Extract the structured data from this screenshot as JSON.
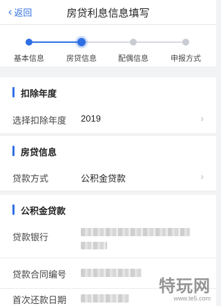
{
  "header": {
    "back_label": "返回",
    "title": "房贷利息信息填写"
  },
  "steps": [
    {
      "label": "基本信息",
      "state": "done"
    },
    {
      "label": "房贷信息",
      "state": "current"
    },
    {
      "label": "配偶信息",
      "state": "todo"
    },
    {
      "label": "申报方式",
      "state": "todo"
    }
  ],
  "sections": {
    "deduction_year": {
      "title": "扣除年度",
      "select_label": "选择扣除年度",
      "select_value": "2019"
    },
    "loan_info": {
      "title": "房贷信息",
      "method_label": "贷款方式",
      "method_value": "公积金贷款"
    },
    "provident_loan": {
      "title": "公积金贷款",
      "bank_label": "贷款银行",
      "contract_label": "贷款合同编号",
      "first_payment_label": "首次还款日期"
    }
  },
  "colors": {
    "accent": "#2f6fe4",
    "inactive": "#c9ccd2"
  },
  "watermark": {
    "main": "特玩网",
    "url": "www.te5.com"
  }
}
